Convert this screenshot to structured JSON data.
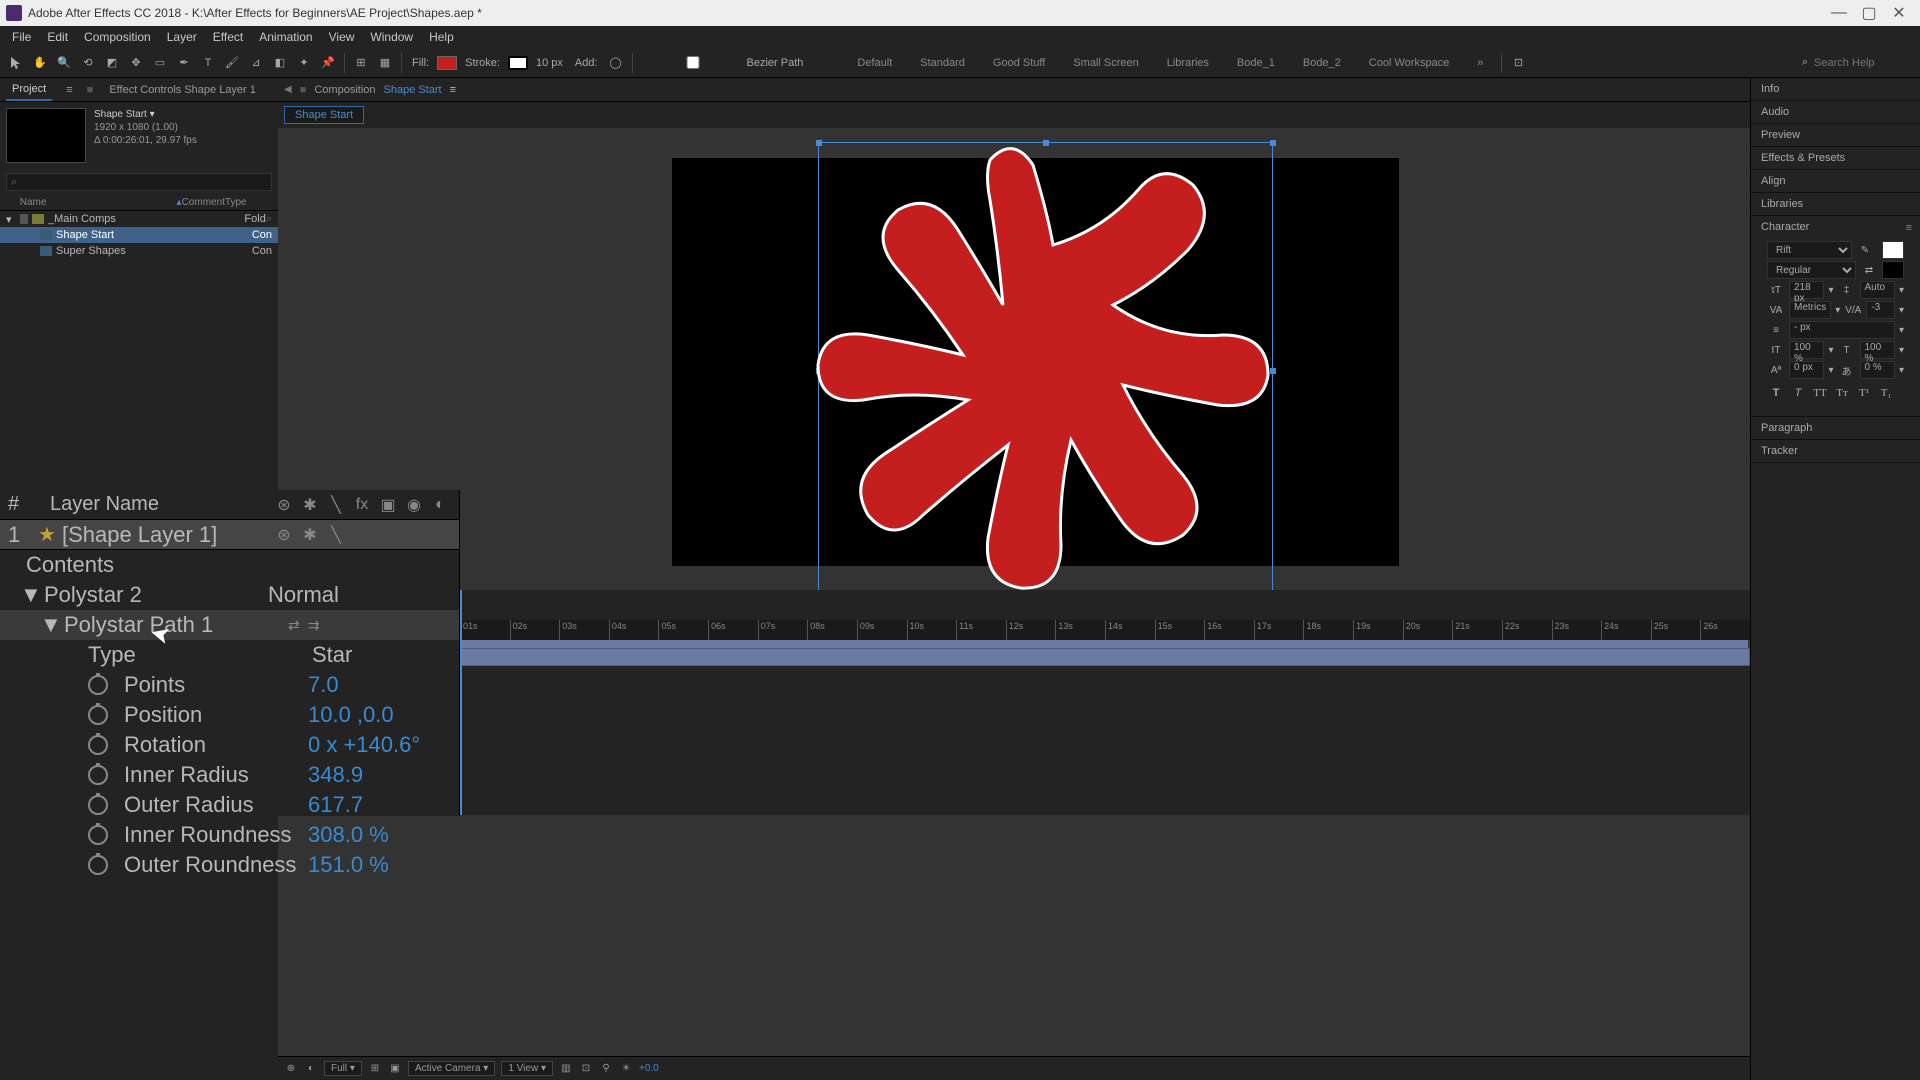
{
  "app": {
    "title": "Adobe After Effects CC 2018 - K:\\After Effects for Beginners\\AE Project\\Shapes.aep *"
  },
  "menu": [
    "File",
    "Edit",
    "Composition",
    "Layer",
    "Effect",
    "Animation",
    "View",
    "Window",
    "Help"
  ],
  "toolbar": {
    "fill_label": "Fill:",
    "stroke_label": "Stroke:",
    "stroke_px": "10 px",
    "add_label": "Add:",
    "bezier": "Bezier Path",
    "workspaces": [
      "Default",
      "Standard",
      "Good Stuff",
      "Small Screen",
      "Libraries",
      "Bode_1",
      "Bode_2",
      "Cool Workspace"
    ],
    "search_ph": "Search Help"
  },
  "project": {
    "tab1": "Project",
    "tab2": "Effect Controls Shape Layer 1",
    "comp_name": "Shape Start",
    "comp_info1": "1920 x 1080 (1.00)",
    "comp_info2": "Δ 0:00:26:01, 29.97 fps",
    "cols": {
      "name": "Name",
      "comment": "Comment",
      "type": "Type"
    },
    "folder": "_Main Comps",
    "folder_type": "Fold",
    "item1": "Shape Start",
    "item1_type": "Con",
    "item2": "Super Shapes",
    "item2_type": "Con"
  },
  "comp_header": {
    "label": "Composition",
    "name": "Shape Start",
    "tab": "Shape Start"
  },
  "viewer_footer": {
    "res": "Full",
    "camera": "Active Camera",
    "views": "1 View",
    "exp": "+0.0"
  },
  "layer": {
    "col_num": "#",
    "col_name": "Layer Name",
    "num": "1",
    "name": "Shape Layer 1",
    "contents": "Contents",
    "polystar": "Polystar 2",
    "mode": "Normal",
    "path": "Polystar Path 1",
    "props": {
      "type": {
        "l": "Type",
        "v": "Star"
      },
      "points": {
        "l": "Points",
        "v": "7.0"
      },
      "position": {
        "l": "Position",
        "v": "10.0 ,0.0"
      },
      "rotation": {
        "l": "Rotation",
        "v": "0 x +140.6°"
      },
      "inner_radius": {
        "l": "Inner Radius",
        "v": "348.9"
      },
      "outer_radius": {
        "l": "Outer Radius",
        "v": "617.7"
      },
      "inner_round": {
        "l": "Inner Roundness",
        "v": "308.0 %"
      },
      "outer_round": {
        "l": "Outer Roundness",
        "v": "151.0 %"
      }
    }
  },
  "right": {
    "panels": [
      "Info",
      "Audio",
      "Preview",
      "Effects & Presets",
      "Align",
      "Libraries"
    ],
    "char_title": "Character",
    "para_title": "Paragraph",
    "tracker_title": "Tracker",
    "font": "Rift",
    "weight": "Regular",
    "size": "218 px",
    "leading": "Auto",
    "kerning": "Metrics",
    "tracking": "-3",
    "stroke_w": "- px",
    "vscale": "100 %",
    "hscale": "100 %",
    "baseline": "0 px",
    "tsume": "0 %"
  },
  "timeline": {
    "ticks": [
      "01s",
      "02s",
      "03s",
      "04s",
      "05s",
      "06s",
      "07s",
      "08s",
      "09s",
      "10s",
      "11s",
      "12s",
      "13s",
      "14s",
      "15s",
      "16s",
      "17s",
      "18s",
      "19s",
      "20s",
      "21s",
      "22s",
      "23s",
      "24s",
      "25s",
      "26s"
    ]
  },
  "colors": {
    "fill": "#C41E1E",
    "accent": "#3a8ad0"
  }
}
